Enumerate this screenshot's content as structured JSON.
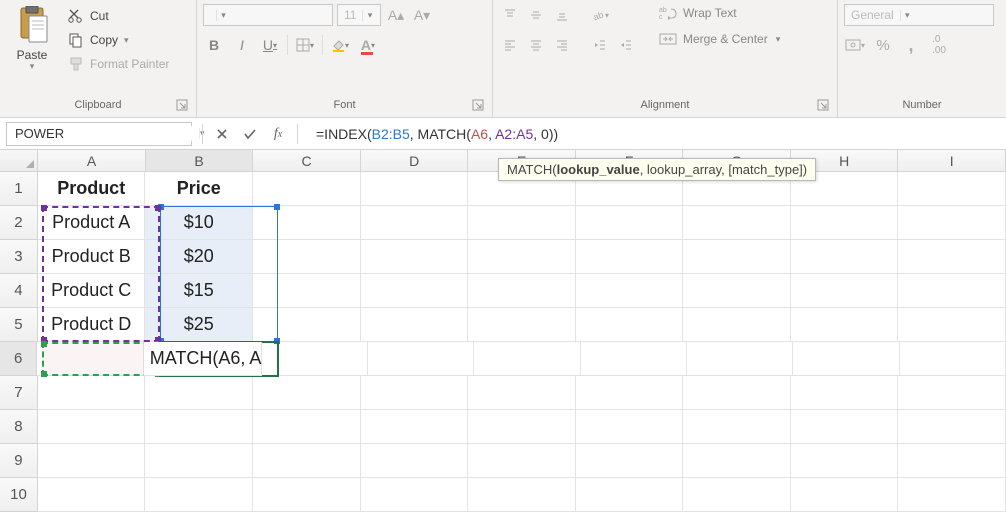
{
  "ribbon": {
    "clipboard": {
      "label": "Clipboard",
      "paste": "Paste",
      "cut": "Cut",
      "copy": "Copy",
      "format_painter": "Format Painter"
    },
    "font": {
      "label": "Font",
      "size": "11",
      "bold": "B",
      "italic": "I",
      "underline": "U"
    },
    "alignment": {
      "label": "Alignment",
      "wrap_text": "Wrap Text",
      "merge_center": "Merge & Center"
    },
    "number": {
      "label": "Number",
      "format": "General",
      "percent": "%",
      "comma": ","
    }
  },
  "formula_bar": {
    "name_box": "POWER",
    "prefix": "=INDEX(",
    "rng1": "B2:B5",
    "sep1": ", ",
    "fn2": "MATCH(",
    "rng2": "A6",
    "sep2": ", ",
    "rng3": "A2:A5",
    "sep3": ", ",
    "num": "0",
    "suffix": "))"
  },
  "tooltip": {
    "fn": "MATCH",
    "arg1": "lookup_value",
    "arg2": "lookup_array",
    "arg3": "[match_type]"
  },
  "columns": [
    "A",
    "B",
    "C",
    "D",
    "E",
    "F",
    "G",
    "H",
    "I"
  ],
  "row_numbers": [
    1,
    2,
    3,
    4,
    5,
    6,
    7,
    8,
    9,
    10
  ],
  "grid": {
    "A1": "Product",
    "B1": "Price",
    "A2": "Product A",
    "B2": "$10",
    "A3": "Product B",
    "B3": "$20",
    "A4": "Product C",
    "B4": "$15",
    "A5": "Product D",
    "B5": "$25",
    "B6_display": "MATCH(A6, A"
  }
}
